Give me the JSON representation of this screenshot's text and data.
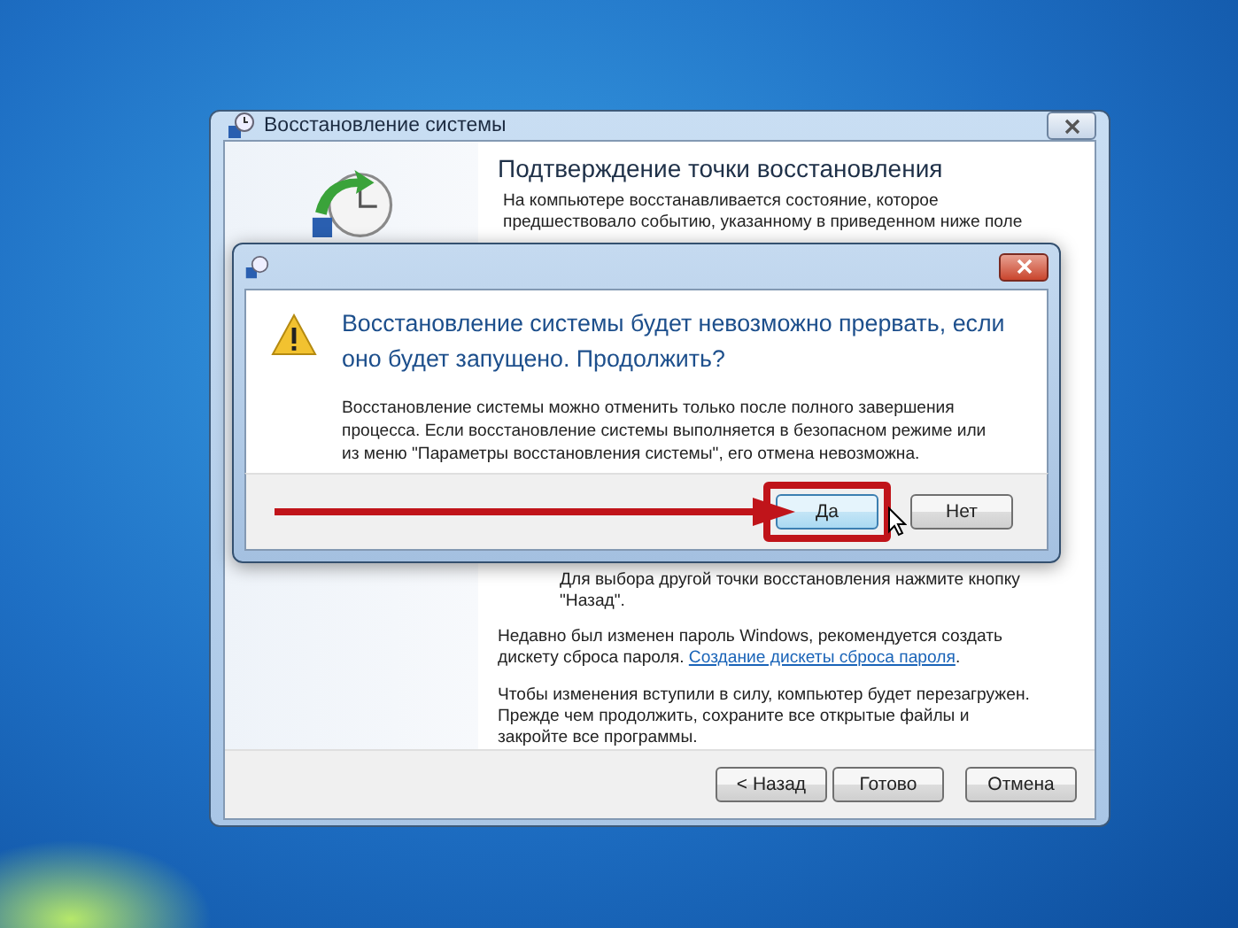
{
  "wizard": {
    "title": "Восстановление системы",
    "heading": "Подтверждение точки восстановления",
    "intro": "На компьютере восстанавливается состояние, которое\nпредшествовало событию, указанному в приведенном ниже поле",
    "hint": "Для выбора другой точки восстановления нажмите кнопку\n\"Назад\".",
    "password_note": "Недавно был изменен пароль Windows, рекомендуется создать\nдискету сброса пароля. ",
    "password_link": "Создание дискеты сброса пароля",
    "password_note_end": ".",
    "restart_note": "Чтобы изменения вступили в силу, компьютер будет перезагружен.\nПрежде чем продолжить, сохраните все открытые файлы и\nзакройте все программы.",
    "buttons": [
      "< Назад",
      "Готово",
      "Отмена"
    ]
  },
  "dialog": {
    "instruction": "Восстановление системы будет невозможно прервать, если\nоно будет запущено. Продолжить?",
    "body": "Восстановление системы можно отменить только после полного завершения\nпроцесса. Если восстановление системы выполняется в безопасном режиме или\nиз меню \"Параметры восстановления системы\", его отмена невозможна.",
    "buttons": [
      {
        "label": "Да",
        "default": true,
        "highlighted": true
      },
      {
        "label": "Нет",
        "default": false,
        "highlighted": false
      }
    ]
  }
}
